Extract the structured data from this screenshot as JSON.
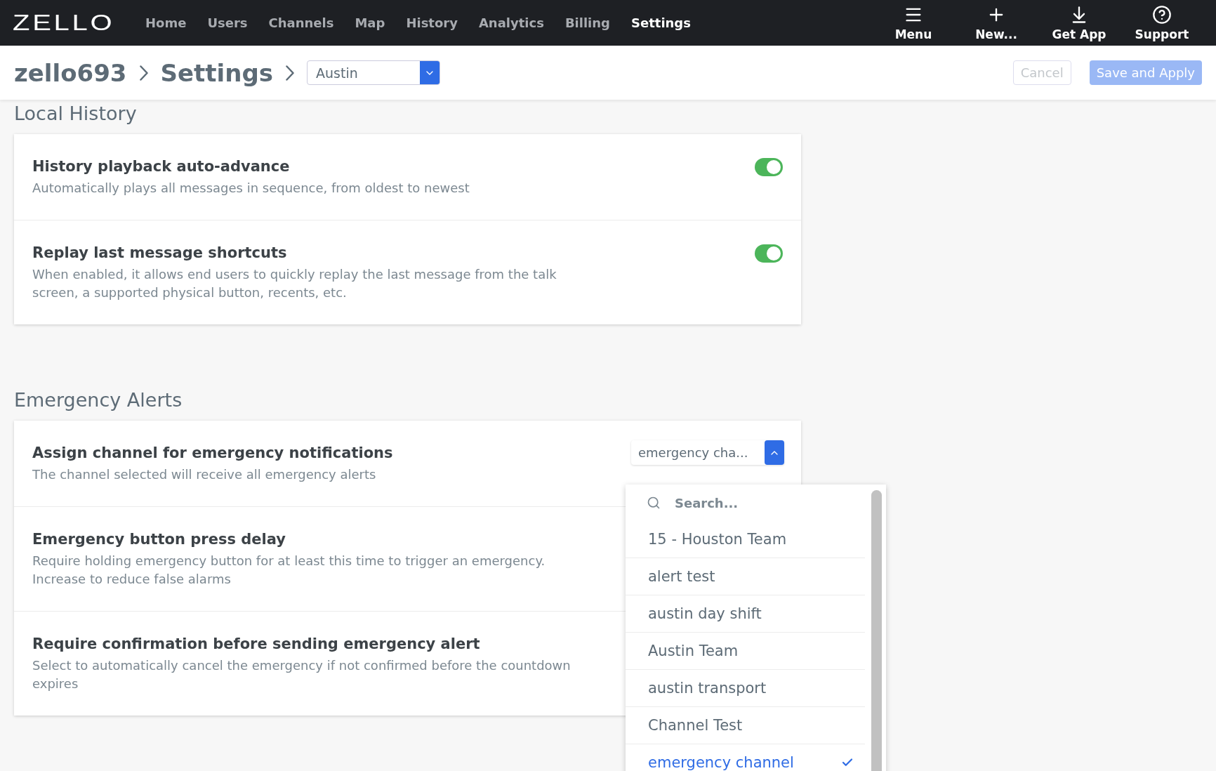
{
  "nav": {
    "logo": "ZELLO",
    "items": [
      {
        "label": "Home",
        "selected": false
      },
      {
        "label": "Users",
        "selected": false
      },
      {
        "label": "Channels",
        "selected": false
      },
      {
        "label": "Map",
        "selected": false
      },
      {
        "label": "History",
        "selected": false
      },
      {
        "label": "Analytics",
        "selected": false
      },
      {
        "label": "Billing",
        "selected": false
      },
      {
        "label": "Settings",
        "selected": true
      }
    ],
    "actions": [
      {
        "kind": "menu",
        "label": "Menu"
      },
      {
        "kind": "new",
        "label": "New..."
      },
      {
        "kind": "download",
        "label": "Get App"
      },
      {
        "kind": "help",
        "label": "Support"
      }
    ]
  },
  "header": {
    "breadcrumbs": [
      "zello693",
      "Settings"
    ],
    "select": {
      "value": "Austin"
    },
    "buttons": [
      {
        "label": "Cancel",
        "kind": "secondary",
        "disabled": true
      },
      {
        "label": "Save and Apply",
        "kind": "primary",
        "disabled": true
      }
    ]
  },
  "sections": [
    {
      "title": "Local History",
      "rows": [
        {
          "title": "History playback auto-advance",
          "description": "Automatically plays all messages in sequence, from oldest to newest",
          "kind": "toggle",
          "on": true
        },
        {
          "title": "Replay last message shortcuts",
          "description": "When enabled, it allows end users to quickly replay the last message from the talk screen, a supported physical button, recents, etc.",
          "kind": "toggle",
          "on": true
        }
      ]
    },
    {
      "title": "Emergency Alerts",
      "rows": [
        {
          "title": "Assign channel for emergency notifications",
          "description": "The channel selected will receive all emergency alerts",
          "kind": "select",
          "value": "emergency cha...",
          "expanded": true
        },
        {
          "title": "Emergency button press delay",
          "description": "Require holding emergency button for at least this time to trigger an emergency. Increase to reduce false alarms",
          "kind": "hidden"
        },
        {
          "title": "Require confirmation before sending emergency alert",
          "description": "Select to automatically cancel the emergency if not confirmed before the countdown expires",
          "kind": "hidden"
        }
      ]
    }
  ],
  "dropdown": {
    "placeholder": "Search...",
    "options": [
      {
        "label": "15 - Houston Team",
        "selected": false
      },
      {
        "label": "alert test",
        "selected": false
      },
      {
        "label": "austin day shift",
        "selected": false
      },
      {
        "label": "Austin Team",
        "selected": false
      },
      {
        "label": "austin transport",
        "selected": false
      },
      {
        "label": "Channel Test",
        "selected": false
      },
      {
        "label": "emergency channel",
        "selected": true
      }
    ]
  }
}
